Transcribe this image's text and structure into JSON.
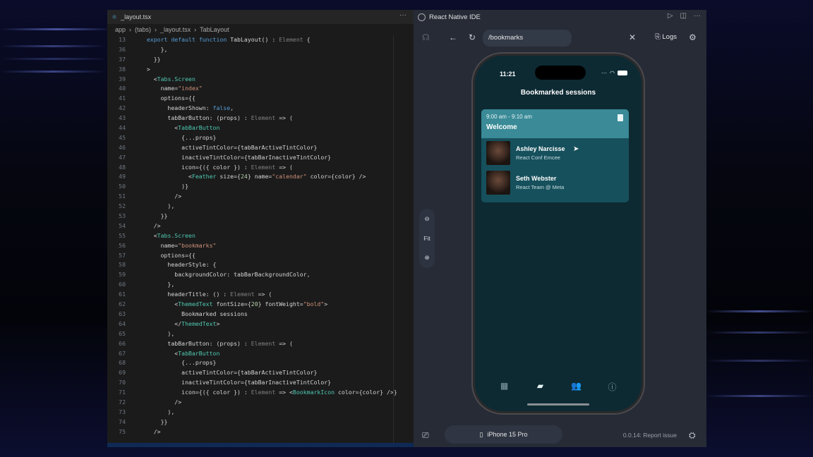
{
  "editor": {
    "tab_title": "_layout.tsx",
    "more": "···",
    "breadcrumb": [
      "app",
      "(tabs)",
      "_layout.tsx",
      "TabLayout"
    ],
    "lines": [
      {
        "n": "13",
        "t": "  export default function TabLayout() : Element {"
      },
      {
        "n": "36",
        "t": "      },"
      },
      {
        "n": "37",
        "t": "    }}"
      },
      {
        "n": "38",
        "t": "  >"
      },
      {
        "n": "39",
        "t": "    <Tabs.Screen"
      },
      {
        "n": "40",
        "t": "      name=\"index\""
      },
      {
        "n": "41",
        "t": "      options={{"
      },
      {
        "n": "42",
        "t": "        headerShown: false,"
      },
      {
        "n": "43",
        "t": "        tabBarButton: (props) : Element => ("
      },
      {
        "n": "44",
        "t": "          <TabBarButton"
      },
      {
        "n": "45",
        "t": "            {...props}"
      },
      {
        "n": "46",
        "t": "            activeTintColor={tabBarActiveTintColor}"
      },
      {
        "n": "47",
        "t": "            inactiveTintColor={tabBarInactiveTintColor}"
      },
      {
        "n": "48",
        "t": "            icon={({ color }) : Element => ("
      },
      {
        "n": "49",
        "t": "              <Feather size={24} name=\"calendar\" color={color} />"
      },
      {
        "n": "50",
        "t": "            )}"
      },
      {
        "n": "51",
        "t": "          />"
      },
      {
        "n": "52",
        "t": "        ),"
      },
      {
        "n": "53",
        "t": "      }}"
      },
      {
        "n": "54",
        "t": "    />"
      },
      {
        "n": "55",
        "t": "    <Tabs.Screen"
      },
      {
        "n": "56",
        "t": "      name=\"bookmarks\""
      },
      {
        "n": "57",
        "t": "      options={{"
      },
      {
        "n": "58",
        "t": "        headerStyle: {"
      },
      {
        "n": "59",
        "t": "          backgroundColor: tabBarBackgroundColor,"
      },
      {
        "n": "60",
        "t": "        },"
      },
      {
        "n": "61",
        "t": "        headerTitle: () : Element => ("
      },
      {
        "n": "62",
        "t": "          <ThemedText fontSize={20} fontWeight=\"bold\">"
      },
      {
        "n": "63",
        "t": "            Bookmarked sessions"
      },
      {
        "n": "64",
        "t": "          </ThemedText>"
      },
      {
        "n": "65",
        "t": "        ),"
      },
      {
        "n": "66",
        "t": "        tabBarButton: (props) : Element => ("
      },
      {
        "n": "67",
        "t": "          <TabBarButton"
      },
      {
        "n": "68",
        "t": "            {...props}"
      },
      {
        "n": "69",
        "t": "            activeTintColor={tabBarActiveTintColor}"
      },
      {
        "n": "70",
        "t": "            inactiveTintColor={tabBarInactiveTintColor}"
      },
      {
        "n": "71",
        "t": "            icon={({ color }) : Element => <BookmarkIcon color={color} />}"
      },
      {
        "n": "72",
        "t": "          />"
      },
      {
        "n": "73",
        "t": "        ),"
      },
      {
        "n": "74",
        "t": "      }}"
      },
      {
        "n": "75",
        "t": "    />"
      }
    ]
  },
  "ide": {
    "title": "React Native IDE",
    "url": "/bookmarks",
    "logs_label": "Logs",
    "zoom_fit": "Fit",
    "device": "iPhone 15 Pro",
    "version_text": "0.0.14: Report issue"
  },
  "phone": {
    "time": "11:21",
    "header_title": "Bookmarked sessions",
    "session": {
      "time": "9:00 am - 9:10 am",
      "title": "Welcome"
    },
    "speakers": [
      {
        "name": "Ashley Narcisse",
        "role": "React Conf Emcee"
      },
      {
        "name": "Seth Webster",
        "role": "React Team @ Meta"
      }
    ],
    "tabs": [
      {
        "icon": "calendar-icon",
        "active": false
      },
      {
        "icon": "bookmark-icon",
        "active": true
      },
      {
        "icon": "people-icon",
        "active": false
      },
      {
        "icon": "info-icon",
        "active": false
      }
    ]
  }
}
